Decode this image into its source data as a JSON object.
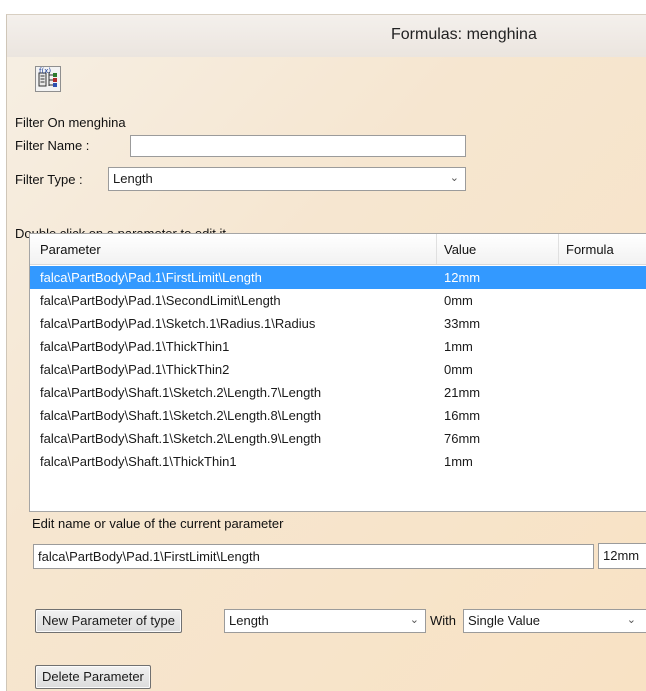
{
  "window": {
    "title": "Formulas: menghina"
  },
  "toolbar": {
    "icon": "formula-tree-icon"
  },
  "filter": {
    "on_label": "Filter On menghina",
    "name_label": "Filter Name :",
    "name_value": "",
    "type_label": "Filter Type :",
    "type_value": "Length"
  },
  "list": {
    "instruction": "Double click on a parameter to edit it",
    "columns": [
      "Parameter",
      "Value",
      "Formula"
    ],
    "rows": [
      {
        "parameter": "falca\\PartBody\\Pad.1\\FirstLimit\\Length",
        "value": "12mm",
        "selected": true
      },
      {
        "parameter": "falca\\PartBody\\Pad.1\\SecondLimit\\Length",
        "value": "0mm"
      },
      {
        "parameter": "falca\\PartBody\\Pad.1\\Sketch.1\\Radius.1\\Radius",
        "value": "33mm"
      },
      {
        "parameter": "falca\\PartBody\\Pad.1\\ThickThin1",
        "value": "1mm"
      },
      {
        "parameter": "falca\\PartBody\\Pad.1\\ThickThin2",
        "value": "0mm"
      },
      {
        "parameter": "falca\\PartBody\\Shaft.1\\Sketch.2\\Length.7\\Length",
        "value": "21mm"
      },
      {
        "parameter": "falca\\PartBody\\Shaft.1\\Sketch.2\\Length.8\\Length",
        "value": "16mm"
      },
      {
        "parameter": "falca\\PartBody\\Shaft.1\\Sketch.2\\Length.9\\Length",
        "value": "76mm"
      },
      {
        "parameter": "falca\\PartBody\\Shaft.1\\ThickThin1",
        "value": "1mm"
      }
    ]
  },
  "edit": {
    "label": "Edit name or value of the current parameter",
    "name_value": "falca\\PartBody\\Pad.1\\FirstLimit\\Length",
    "value_value": "12mm"
  },
  "new_param": {
    "button_label": "New Parameter of type",
    "type_value": "Length",
    "with_label": "With",
    "with_value": "Single Value"
  },
  "delete": {
    "button_label": "Delete Parameter"
  }
}
